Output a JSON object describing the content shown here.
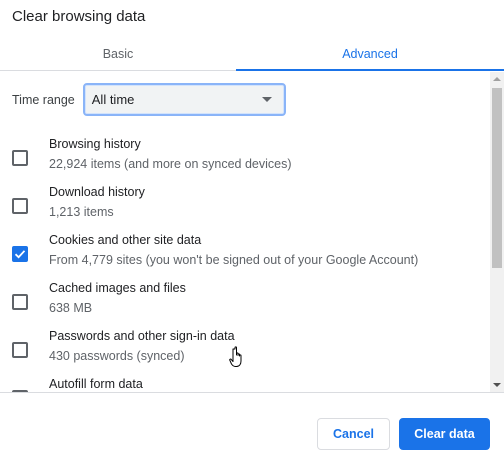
{
  "dialog": {
    "title": "Clear browsing data"
  },
  "tabs": [
    {
      "label": "Basic",
      "active": false
    },
    {
      "label": "Advanced",
      "active": true
    }
  ],
  "time_range": {
    "label": "Time range",
    "selected": "All time"
  },
  "items": [
    {
      "title": "Browsing history",
      "description": "22,924 items (and more on synced devices)",
      "checked": false
    },
    {
      "title": "Download history",
      "description": "1,213 items",
      "checked": false
    },
    {
      "title": "Cookies and other site data",
      "description": "From 4,779 sites (you won't be signed out of your Google Account)",
      "checked": true
    },
    {
      "title": "Cached images and files",
      "description": "638 MB",
      "checked": false
    },
    {
      "title": "Passwords and other sign-in data",
      "description": "430 passwords (synced)",
      "checked": false
    },
    {
      "title": "Autofill form data",
      "description": "",
      "checked": false
    }
  ],
  "buttons": {
    "cancel": "Cancel",
    "clear": "Clear data"
  },
  "colors": {
    "accent": "#1a73e8",
    "text": "#202124",
    "secondary": "#5f6368"
  },
  "icons": {
    "checkmark": "check-icon",
    "dropdown": "caret-down-icon",
    "cursor": "hand-pointer-icon"
  }
}
